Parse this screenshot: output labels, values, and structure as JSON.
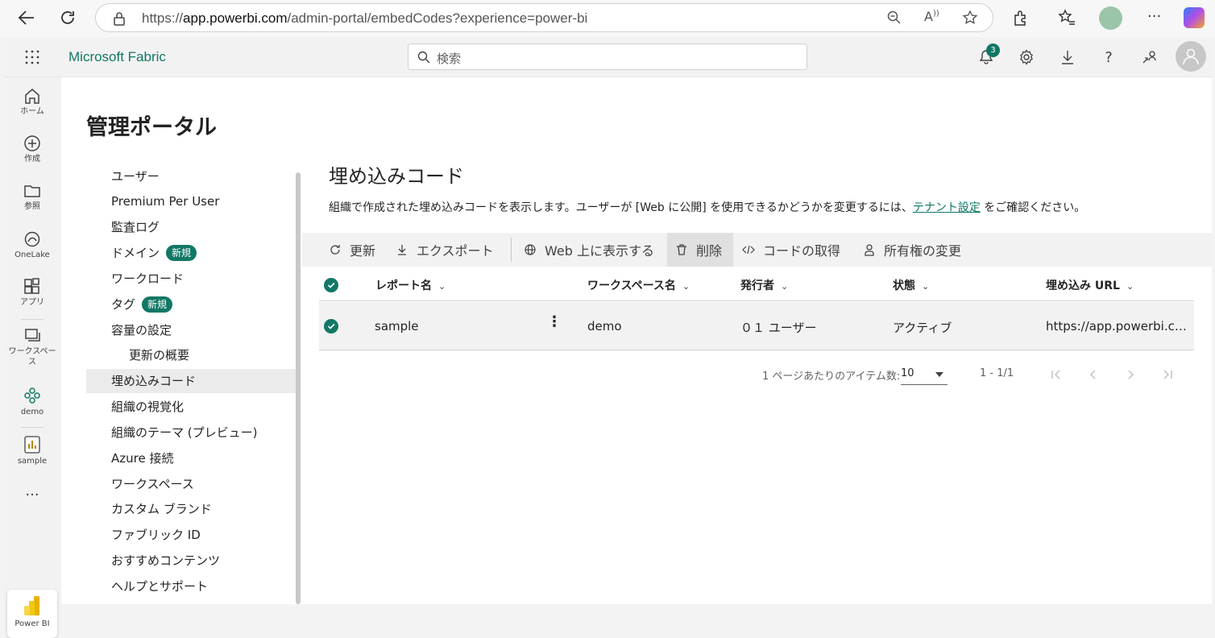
{
  "browser": {
    "url_prefix": "https://",
    "url_host": "app.powerbi.com",
    "url_path": "/admin-portal/embedCodes?experience=power-bi"
  },
  "topbar": {
    "brand": "Microsoft Fabric",
    "search_placeholder": "検索",
    "notification_count": "3"
  },
  "rail": {
    "items": [
      {
        "label": "ホーム",
        "icon": "home-icon"
      },
      {
        "label": "作成",
        "icon": "create-icon"
      },
      {
        "label": "参照",
        "icon": "folder-icon"
      },
      {
        "label": "OneLake",
        "icon": "onelake-icon"
      },
      {
        "label": "アプリ",
        "icon": "apps-icon"
      },
      {
        "label": "ワークスペース",
        "icon": "workspaces-icon"
      },
      {
        "label": "demo",
        "icon": "workspace-demo-icon"
      },
      {
        "label": "sample",
        "icon": "report-icon"
      }
    ],
    "more": "···",
    "switcher_label": "Power BI"
  },
  "page_title": "管理ポータル",
  "nav": {
    "items": [
      {
        "label": "ユーザー"
      },
      {
        "label": "Premium Per User"
      },
      {
        "label": "監査ログ"
      },
      {
        "label": "ドメイン",
        "badge": "新規"
      },
      {
        "label": "ワークロード"
      },
      {
        "label": "タグ",
        "badge": "新規"
      },
      {
        "label": "容量の設定"
      },
      {
        "label": "更新の概要"
      },
      {
        "label": "埋め込みコード"
      },
      {
        "label": "組織の視覚化"
      },
      {
        "label": "組織のテーマ (プレビュー)"
      },
      {
        "label": "Azure 接続"
      },
      {
        "label": "ワークスペース"
      },
      {
        "label": "カスタム ブランド"
      },
      {
        "label": "ファブリック ID"
      },
      {
        "label": "おすすめコンテンツ"
      },
      {
        "label": "ヘルプとサポート"
      }
    ]
  },
  "main": {
    "title": "埋め込みコード",
    "description_before": "組織で作成された埋め込みコードを表示します。ユーザーが [Web に公開] を使用できるかどうかを変更するには、",
    "description_link": "テナント設定",
    "description_after": " をご確認ください。",
    "toolbar": {
      "refresh": "更新",
      "export": "エクスポート",
      "show_on_web": "Web 上に表示する",
      "delete": "削除",
      "get_code": "コードの取得",
      "change_owner": "所有権の変更"
    },
    "columns": [
      "レポート名",
      "ワークスペース名",
      "発行者",
      "状態",
      "埋め込み URL"
    ],
    "rows": [
      {
        "report": "sample",
        "workspace": "demo",
        "publisher": "０１ ユーザー",
        "status": "アクティブ",
        "url": "https://app.powerbi.com/..."
      }
    ],
    "pager": {
      "items_per_page_label": "1 ページあたりのアイテム数:",
      "items_per_page": "10",
      "range": "1 - 1/1"
    }
  }
}
